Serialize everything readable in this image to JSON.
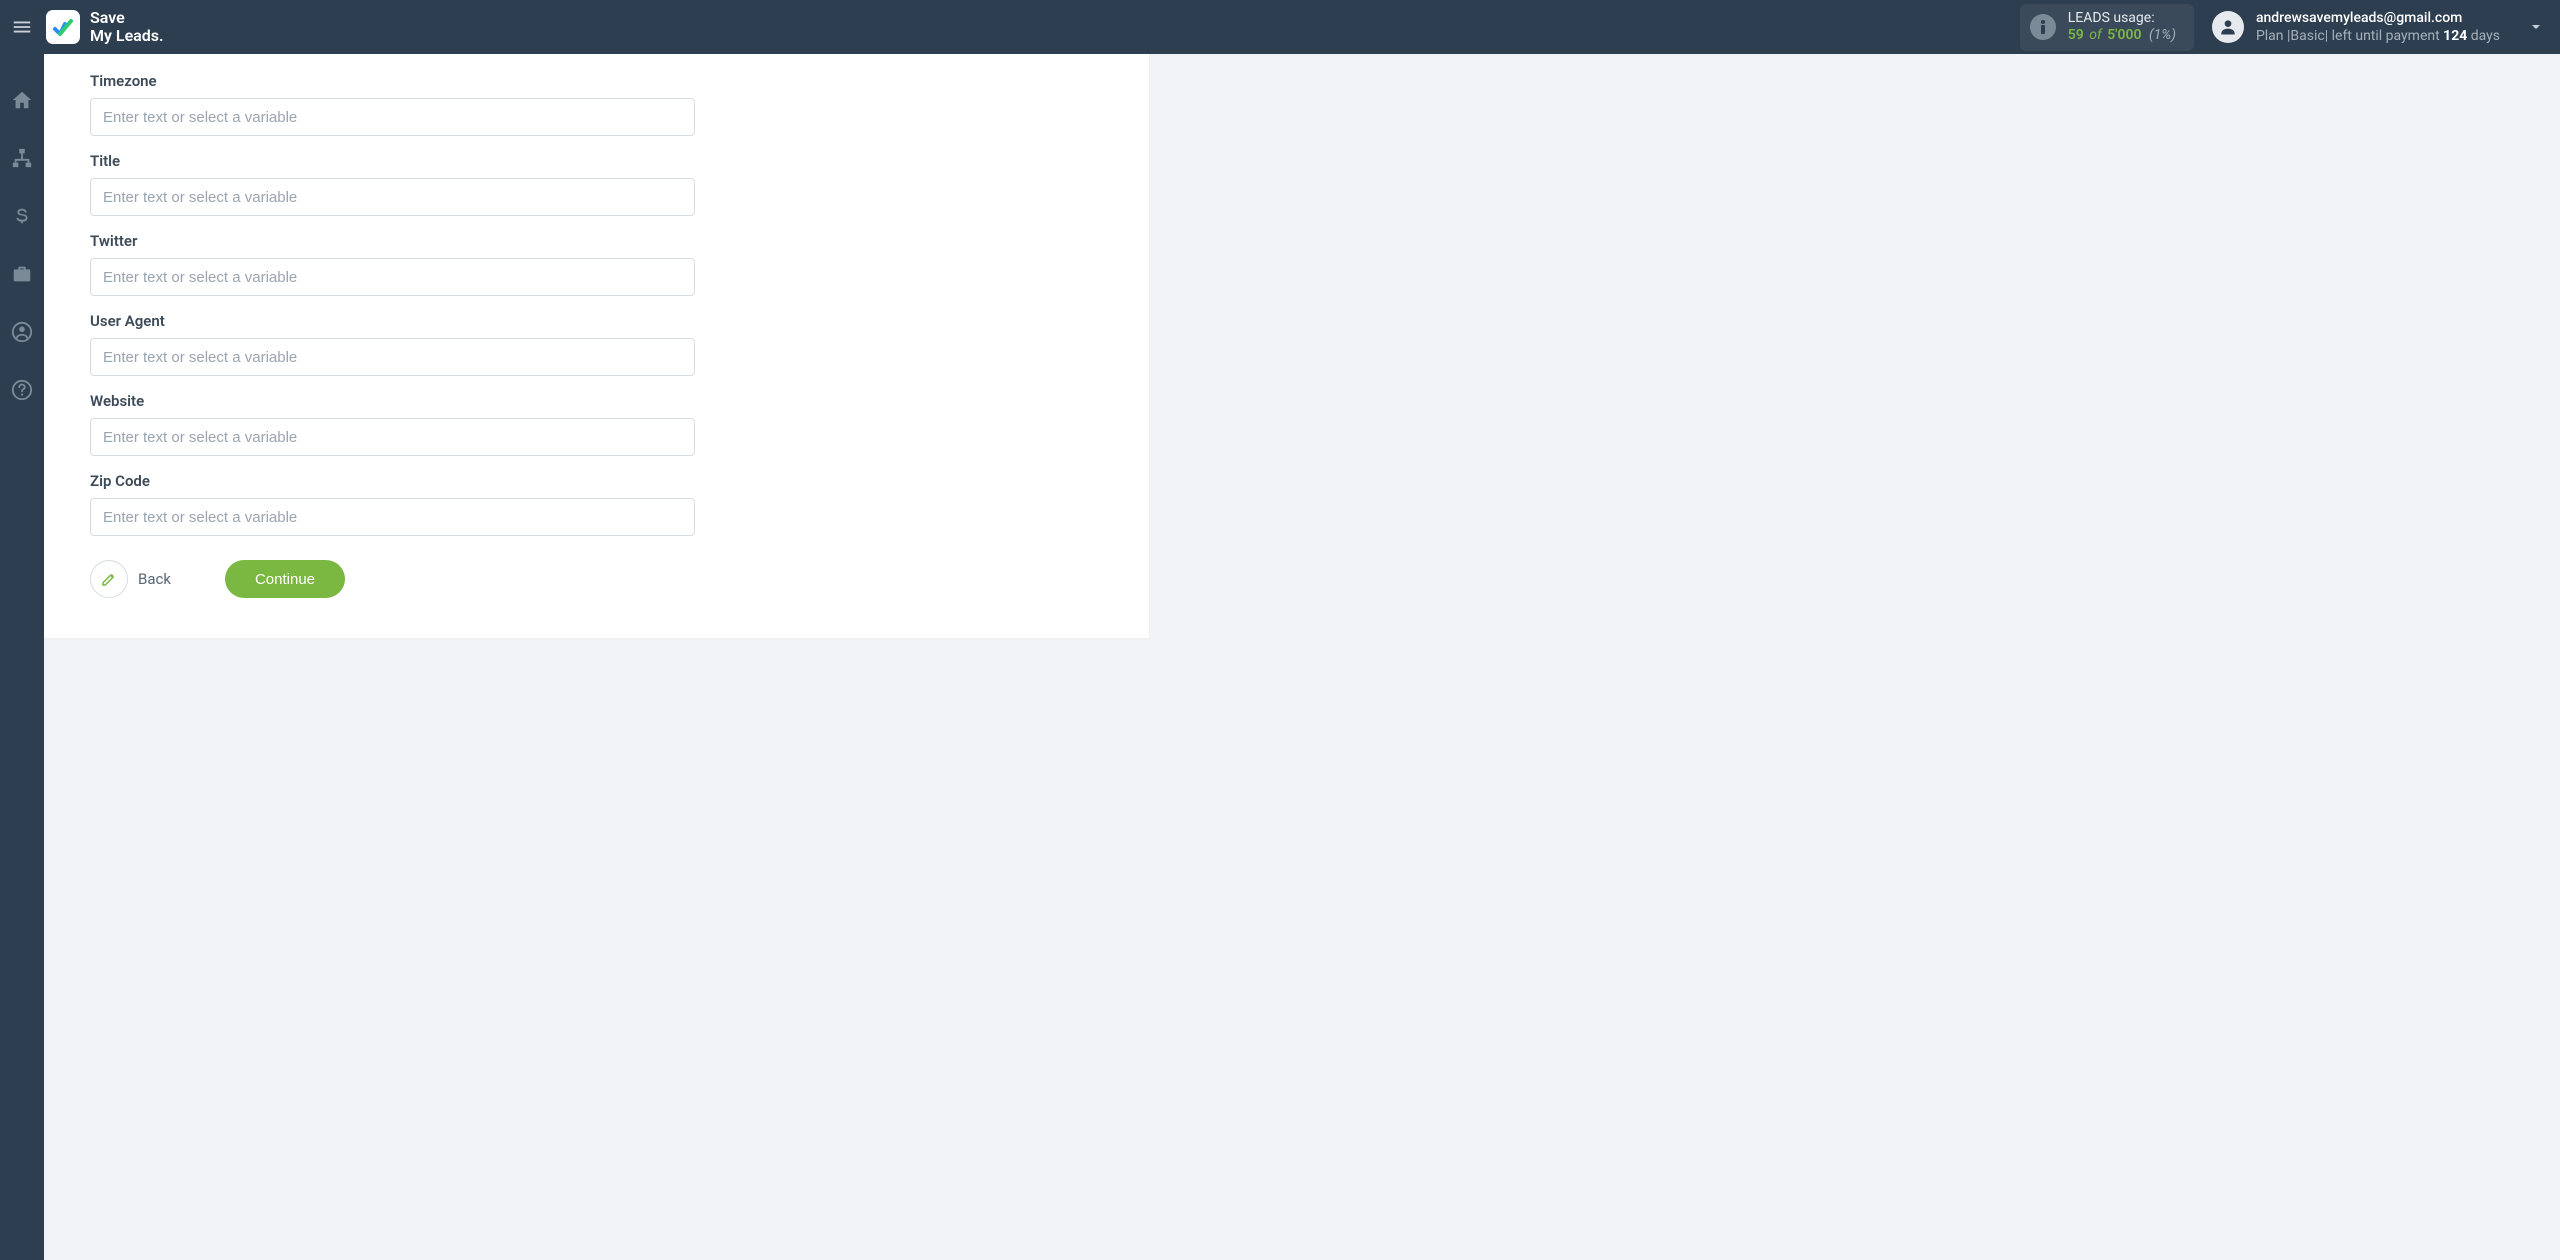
{
  "brand": {
    "line1": "Save",
    "line2": "My Leads."
  },
  "usage": {
    "label": "LEADS usage:",
    "count": "59",
    "of": "of",
    "total": "5'000",
    "pct": "(1%)"
  },
  "account": {
    "email": "andrewsavemyleads@gmail.com",
    "plan_prefix": "Plan |",
    "plan_name": "Basic",
    "plan_suffix": "| left until payment ",
    "days": "124",
    "days_suffix": " days"
  },
  "form": {
    "fields": [
      {
        "label": "Timezone",
        "placeholder": "Enter text or select a variable"
      },
      {
        "label": "Title",
        "placeholder": "Enter text or select a variable"
      },
      {
        "label": "Twitter",
        "placeholder": "Enter text or select a variable"
      },
      {
        "label": "User Agent",
        "placeholder": "Enter text or select a variable"
      },
      {
        "label": "Website",
        "placeholder": "Enter text or select a variable"
      },
      {
        "label": "Zip Code",
        "placeholder": "Enter text or select a variable"
      }
    ],
    "back_label": "Back",
    "continue_label": "Continue"
  }
}
